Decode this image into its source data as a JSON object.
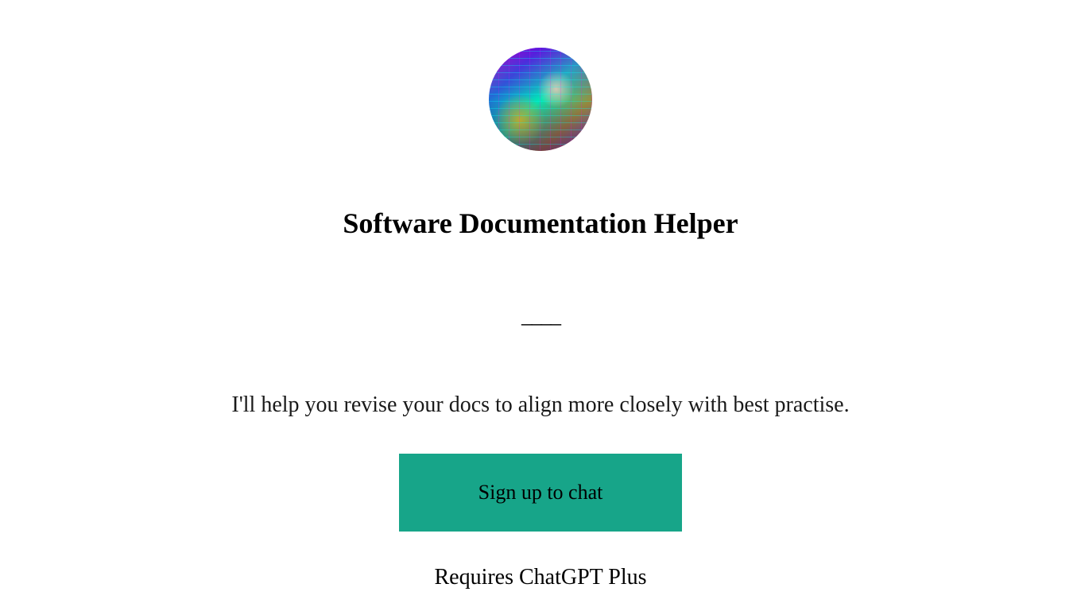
{
  "main": {
    "title": "Software Documentation Helper",
    "divider": "____",
    "description": "I'll help you revise your docs to align more closely with best practise.",
    "signup_button_label": "Sign up to chat",
    "requires_text": "Requires ChatGPT Plus"
  }
}
